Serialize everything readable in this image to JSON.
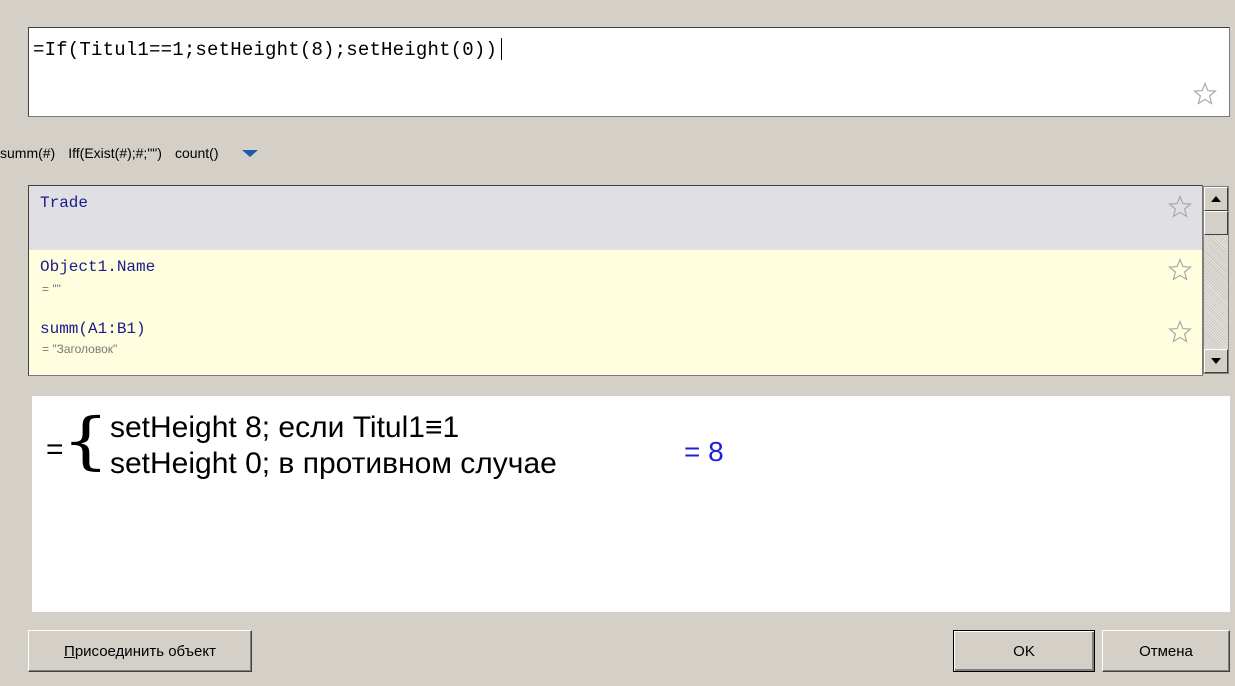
{
  "formula": {
    "text": "=If(Titul1==1;setHeight(8);setHeight(0))"
  },
  "quick_functions": {
    "items": [
      "summ(#)",
      "Iff(Exist(#);#;\"\")",
      "count()"
    ]
  },
  "list": {
    "header": {
      "name": "Trade"
    },
    "rows": [
      {
        "name": "Object1.Name",
        "value": "= \"\""
      },
      {
        "name": "summ(A1:B1)",
        "value": "= \"Заголовок\""
      }
    ]
  },
  "preview": {
    "equals": "=",
    "case1": "setHeight 8; если Titul1≡1",
    "case2": "setHeight 0; в противном случае",
    "result": "= 8"
  },
  "buttons": {
    "attach": "Присоединить объект",
    "ok": "OK",
    "cancel": "Отмена"
  },
  "icons": {
    "favorite": "star-outline-icon",
    "dropdown": "chevron-down-icon"
  },
  "colors": {
    "dialog_bg": "#d4d0c8",
    "list_name": "#1a1a8c",
    "result": "#1f1fd8",
    "dropdown_arrow": "#1a5aa8",
    "row_highlight": "#ffffdf"
  }
}
